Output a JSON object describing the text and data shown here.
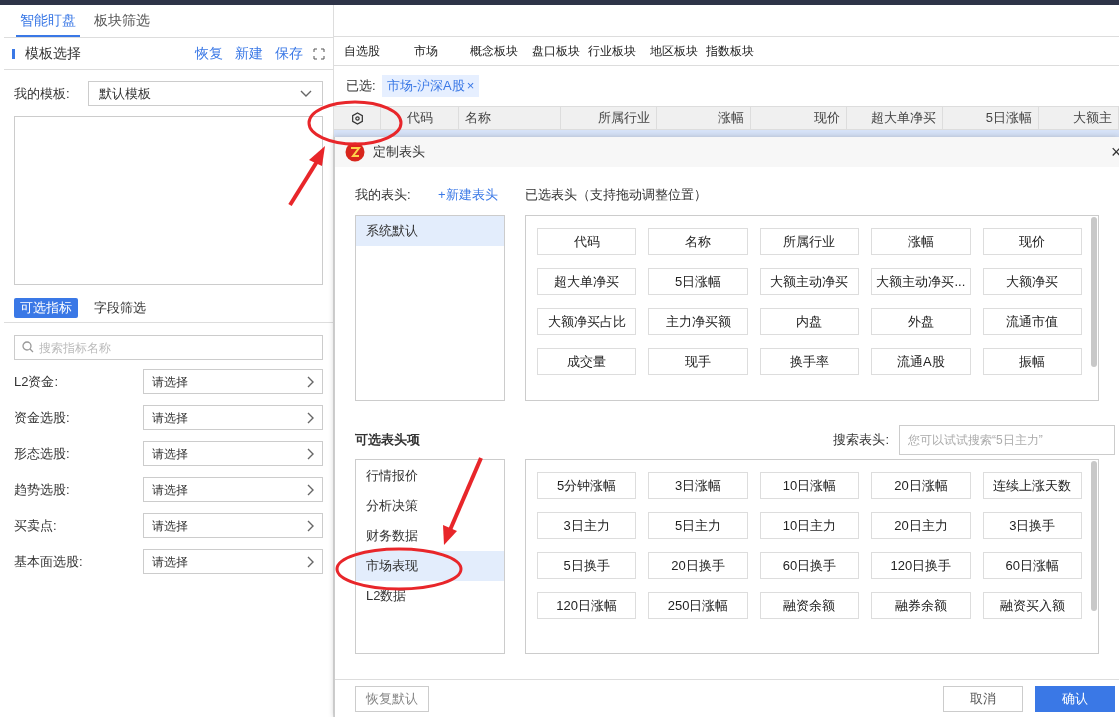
{
  "top_tabs": [
    {
      "label": "智能盯盘",
      "selected": true
    },
    {
      "label": "板块筛选",
      "selected": false
    }
  ],
  "template_panel": {
    "title": "模板选择",
    "actions": [
      "恢复",
      "新建",
      "保存"
    ],
    "my_template_label": "我的模板:",
    "my_template_value": "默认模板"
  },
  "indicator_tabs": [
    {
      "label": "可选指标",
      "selected": true
    },
    {
      "label": "字段筛选",
      "selected": false
    }
  ],
  "indicator_search": {
    "placeholder": "搜索指标名称"
  },
  "indicator_rows": [
    {
      "label": "L2资金:",
      "value": "请选择"
    },
    {
      "label": "资金选股:",
      "value": "请选择"
    },
    {
      "label": "形态选股:",
      "value": "请选择"
    },
    {
      "label": "趋势选股:",
      "value": "请选择"
    },
    {
      "label": "买卖点:",
      "value": "请选择"
    },
    {
      "label": "基本面选股:",
      "value": "请选择"
    }
  ],
  "market_tabs": [
    "自选股",
    "市场",
    "概念板块",
    "盘口板块",
    "行业板块",
    "地区板块",
    "指数板块"
  ],
  "selected_filter": {
    "label": "已选:",
    "tag": "市场-沪深A股",
    "remove": "×"
  },
  "table": {
    "columns": [
      "代码",
      "名称",
      "所属行业",
      "涨幅",
      "现价",
      "超大单净买",
      "5日涨幅",
      "大额主"
    ]
  },
  "dialog": {
    "title": "定制表头",
    "close": "×",
    "my_headers_label": "我的表头:",
    "new_header": "+新建表头",
    "selected_headers_label": "已选表头（支持拖动调整位置）",
    "header_sets": [
      {
        "label": "系统默认",
        "selected": true
      }
    ],
    "selected_headers": [
      "代码",
      "名称",
      "所属行业",
      "涨幅",
      "现价",
      "超大单净买",
      "5日涨幅",
      "大额主动净买",
      "大额主动净买...",
      "大额净买",
      "大额净买占比",
      "主力净买额",
      "内盘",
      "外盘",
      "流通市值",
      "成交量",
      "现手",
      "换手率",
      "流通A股",
      "振幅"
    ],
    "available_label": "可选表头项",
    "search_label": "搜索表头:",
    "search": {
      "placeholder": "您可以试试搜索“5日主力”"
    },
    "categories": [
      {
        "label": "行情报价",
        "selected": false
      },
      {
        "label": "分析决策",
        "selected": false
      },
      {
        "label": "财务数据",
        "selected": false
      },
      {
        "label": "市场表现",
        "selected": true
      },
      {
        "label": "L2数据",
        "selected": false
      }
    ],
    "available_headers": [
      "5分钟涨幅",
      "3日涨幅",
      "10日涨幅",
      "20日涨幅",
      "连续上涨天数",
      "3日主力",
      "5日主力",
      "10日主力",
      "20日主力",
      "3日换手",
      "5日换手",
      "20日换手",
      "60日换手",
      "120日换手",
      "60日涨幅",
      "120日涨幅",
      "250日涨幅",
      "融资余额",
      "融券余额",
      "融资买入额"
    ],
    "buttons": {
      "restore": "恢复默认",
      "cancel": "取消",
      "confirm": "确认"
    }
  }
}
